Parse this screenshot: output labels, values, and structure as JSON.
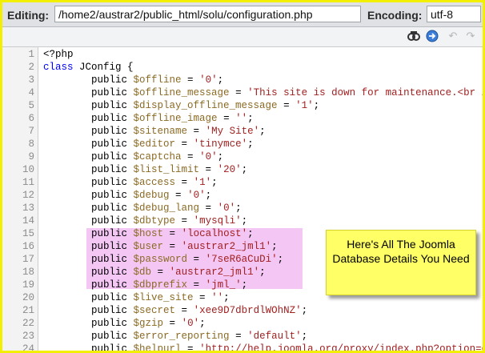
{
  "toolbar": {
    "editing_label": "Editing:",
    "editing_path": "/home2/austrar2/public_html/solu/configuration.php",
    "encoding_label": "Encoding:",
    "encoding_value": "utf-8"
  },
  "tools": [
    {
      "name": "search-icon",
      "glyph": "🔍"
    },
    {
      "name": "goto-icon",
      "glyph": "➔"
    },
    {
      "name": "undo-icon",
      "glyph": "↶"
    },
    {
      "name": "redo-icon",
      "glyph": "↷"
    }
  ],
  "code": {
    "lines": [
      {
        "n": "1",
        "t": "<?php"
      },
      {
        "n": "2",
        "t": "class JConfig {"
      },
      {
        "n": "3",
        "t": "        public $offline = '0';"
      },
      {
        "n": "4",
        "t": "        public $offline_message = 'This site is down for maintenance.<br /> Please"
      },
      {
        "n": "5",
        "t": "        public $display_offline_message = '1';"
      },
      {
        "n": "6",
        "t": "        public $offline_image = '';"
      },
      {
        "n": "7",
        "t": "        public $sitename = 'My Site';"
      },
      {
        "n": "8",
        "t": "        public $editor = 'tinymce';"
      },
      {
        "n": "9",
        "t": "        public $captcha = '0';"
      },
      {
        "n": "10",
        "t": "        public $list_limit = '20';"
      },
      {
        "n": "11",
        "t": "        public $access = '1';"
      },
      {
        "n": "12",
        "t": "        public $debug = '0';"
      },
      {
        "n": "13",
        "t": "        public $debug_lang = '0';"
      },
      {
        "n": "14",
        "t": "        public $dbtype = 'mysqli';"
      },
      {
        "n": "15",
        "t": "        public $host = 'localhost';"
      },
      {
        "n": "16",
        "t": "        public $user = 'austrar2_jml1';"
      },
      {
        "n": "17",
        "t": "        public $password = '7seR6aCuDi';"
      },
      {
        "n": "18",
        "t": "        public $db = 'austrar2_jml1';"
      },
      {
        "n": "19",
        "t": "        public $dbprefix = 'jml_';"
      },
      {
        "n": "20",
        "t": "        public $live_site = '';"
      },
      {
        "n": "21",
        "t": "        public $secret = 'xee9D7dbrdlWOhNZ';"
      },
      {
        "n": "22",
        "t": "        public $gzip = '0';"
      },
      {
        "n": "23",
        "t": "        public $error_reporting = 'default';"
      },
      {
        "n": "24",
        "t": "        public $helpurl = 'http://help.joomla.org/proxy/index.php?option=com_"
      }
    ]
  },
  "callout": {
    "text": "Here's All The Joomla Database Details You Need"
  }
}
